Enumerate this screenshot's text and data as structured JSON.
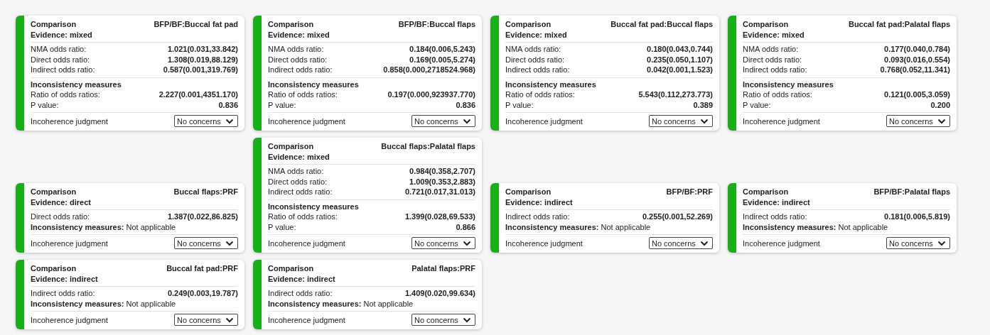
{
  "rows": [
    {
      "cards": [
        {
          "heading": "Comparison",
          "comparison": "BFP/BF:Buccal fat pad",
          "evidence": "Evidence: mixed",
          "estimates": [
            {
              "label": "NMA odds ratio:",
              "value": "1.021(0.031,33.842)"
            },
            {
              "label": "Direct odds ratio:",
              "value": "1.308(0.019,88.129)"
            },
            {
              "label": "Indirect odds ratio:",
              "value": "0.587(0.001,319.769)"
            }
          ],
          "inconsistency": {
            "kind": "measures",
            "title": "Inconsistency measures",
            "rows": [
              {
                "label": "Ratio of odds ratios:",
                "value": "2.227(0.001,4351.170)"
              },
              {
                "label": "P value:",
                "value": "0.836"
              }
            ]
          },
          "judgment": {
            "label": "Incoherence judgment",
            "value": "No concerns"
          }
        },
        {
          "heading": "Comparison",
          "comparison": "BFP/BF:Buccal flaps",
          "evidence": "Evidence: mixed",
          "estimates": [
            {
              "label": "NMA odds ratio:",
              "value": "0.184(0.006,5.243)"
            },
            {
              "label": "Direct odds ratio:",
              "value": "0.169(0.005,5.274)"
            },
            {
              "label": "Indirect odds ratio:",
              "value": "0.858(0.000,2718524.968)"
            }
          ],
          "inconsistency": {
            "kind": "measures",
            "title": "Inconsistency measures",
            "rows": [
              {
                "label": "Ratio of odds ratios:",
                "value": "0.197(0.000,923937.770)"
              },
              {
                "label": "P value:",
                "value": "0.836"
              }
            ]
          },
          "judgment": {
            "label": "Incoherence judgment",
            "value": "No concerns"
          }
        },
        {
          "heading": "Comparison",
          "comparison": "Buccal fat pad:Buccal flaps",
          "evidence": "Evidence: mixed",
          "estimates": [
            {
              "label": "NMA odds ratio:",
              "value": "0.180(0.043,0.744)"
            },
            {
              "label": "Direct odds ratio:",
              "value": "0.235(0.050,1.107)"
            },
            {
              "label": "Indirect odds ratio:",
              "value": "0.042(0.001,1.523)"
            }
          ],
          "inconsistency": {
            "kind": "measures",
            "title": "Inconsistency measures",
            "rows": [
              {
                "label": "Ratio of odds ratios:",
                "value": "5.543(0.112,273.773)"
              },
              {
                "label": "P value:",
                "value": "0.389"
              }
            ]
          },
          "judgment": {
            "label": "Incoherence judgment",
            "value": "No concerns"
          }
        },
        {
          "heading": "Comparison",
          "comparison": "Buccal fat pad:Palatal flaps",
          "evidence": "Evidence: mixed",
          "estimates": [
            {
              "label": "NMA odds ratio:",
              "value": "0.177(0.040,0.784)"
            },
            {
              "label": "Direct odds ratio:",
              "value": "0.093(0.016,0.554)"
            },
            {
              "label": "Indirect odds ratio:",
              "value": "0.768(0.052,11.341)"
            }
          ],
          "inconsistency": {
            "kind": "measures",
            "title": "Inconsistency measures",
            "rows": [
              {
                "label": "Ratio of odds ratios:",
                "value": "0.121(0.005,3.059)"
              },
              {
                "label": "P value:",
                "value": "0.200"
              }
            ]
          },
          "judgment": {
            "label": "Incoherence judgment",
            "value": "No concerns"
          }
        }
      ]
    },
    {
      "cards": [
        {
          "heading": "Comparison",
          "comparison": "Buccal flaps:PRF",
          "evidence": "Evidence: direct",
          "estimates": [
            {
              "label": "Direct odds ratio:",
              "value": "1.387(0.022,86.825)"
            }
          ],
          "inconsistency": {
            "kind": "note",
            "text": "**Inconsistency measures:** Not applicable"
          },
          "judgment": {
            "label": "Incoherence judgment",
            "value": "No concerns"
          }
        },
        {
          "heading": "Comparison",
          "comparison": "Buccal flaps:Palatal flaps",
          "evidence": "Evidence: mixed",
          "estimates": [
            {
              "label": "NMA odds ratio:",
              "value": "0.984(0.358,2.707)"
            },
            {
              "label": "Direct odds ratio:",
              "value": "1.009(0.353,2.883)"
            },
            {
              "label": "Indirect odds ratio:",
              "value": "0.721(0.017,31.013)"
            }
          ],
          "inconsistency": {
            "kind": "measures",
            "title": "Inconsistency measures",
            "rows": [
              {
                "label": "Ratio of odds ratios:",
                "value": "1.399(0.028,69.533)"
              },
              {
                "label": "P value:",
                "value": "0.866"
              }
            ]
          },
          "judgment": {
            "label": "Incoherence judgment",
            "value": "No concerns"
          }
        },
        {
          "heading": "Comparison",
          "comparison": "BFP/BF:PRF",
          "evidence": "Evidence: indirect",
          "estimates": [
            {
              "label": "Indirect odds ratio:",
              "value": "0.255(0.001,52.269)"
            }
          ],
          "inconsistency": {
            "kind": "note",
            "text": "**Inconsistency measures:** Not applicable"
          },
          "judgment": {
            "label": "Incoherence judgment",
            "value": "No concerns"
          }
        },
        {
          "heading": "Comparison",
          "comparison": "BFP/BF:Palatal flaps",
          "evidence": "Evidence: indirect",
          "estimates": [
            {
              "label": "Indirect odds ratio:",
              "value": "0.181(0.006,5.819)"
            }
          ],
          "inconsistency": {
            "kind": "note",
            "text": "**Inconsistency measures:** Not applicable"
          },
          "judgment": {
            "label": "Incoherence judgment",
            "value": "No concerns"
          }
        }
      ]
    },
    {
      "cards": [
        {
          "heading": "Comparison",
          "comparison": "Buccal fat pad:PRF",
          "evidence": "Evidence: indirect",
          "estimates": [
            {
              "label": "Indirect odds ratio:",
              "value": "0.249(0.003,19.787)"
            }
          ],
          "inconsistency": {
            "kind": "note",
            "text": "**Inconsistency measures:** Not applicable"
          },
          "judgment": {
            "label": "Incoherence judgment",
            "value": "No concerns"
          }
        },
        {
          "heading": "Comparison",
          "comparison": "Palatal flaps:PRF",
          "evidence": "Evidence: indirect",
          "estimates": [
            {
              "label": "Indirect odds ratio:",
              "value": "1.409(0.020,99.634)"
            }
          ],
          "inconsistency": {
            "kind": "note",
            "text": "**Inconsistency measures:** Not applicable"
          },
          "judgment": {
            "label": "Incoherence judgment",
            "value": "No concerns"
          }
        }
      ]
    }
  ]
}
